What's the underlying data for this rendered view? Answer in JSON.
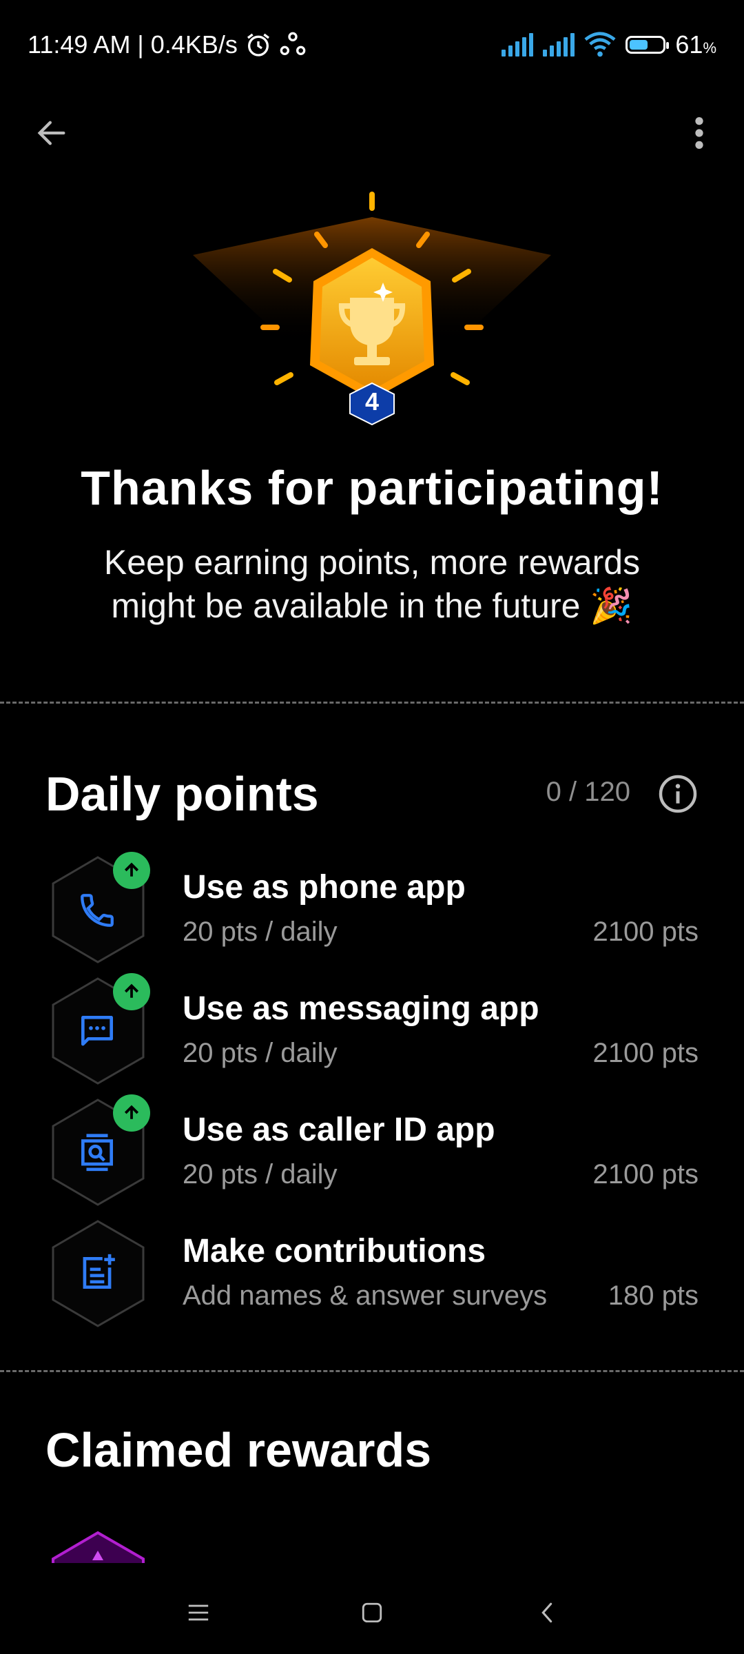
{
  "status_bar": {
    "time_speed": "11:49 AM | 0.4KB/s",
    "battery": "61",
    "battery_unit": "%",
    "battery_level_percent": 61,
    "icons": [
      "alarm-icon",
      "sync-icon",
      "signal-icon",
      "signal-icon",
      "wifi-icon",
      "battery-icon"
    ]
  },
  "toolbar": {
    "back_icon": "arrow-left-icon",
    "more_icon": "more-vert-icon"
  },
  "badge": {
    "level": "4",
    "icon": "trophy-icon"
  },
  "header": {
    "title": "Thanks for participating!",
    "subtitle_line1": "Keep earning points, more rewards",
    "subtitle_line2": "might be available in the future",
    "emoji": "🎉"
  },
  "daily": {
    "title": "Daily points",
    "progress": "0 / 120",
    "info_icon": "info-icon",
    "tasks": [
      {
        "title": "Use as phone app",
        "subtitle": "20 pts / daily",
        "points": "2100 pts",
        "icon": "phone-icon",
        "boosted": true
      },
      {
        "title": "Use as messaging app",
        "subtitle": "20 pts / daily",
        "points": "2100 pts",
        "icon": "message-icon",
        "boosted": true
      },
      {
        "title": "Use as caller ID app",
        "subtitle": "20 pts / daily",
        "points": "2100 pts",
        "icon": "caller-id-icon",
        "boosted": true
      },
      {
        "title": "Make contributions",
        "subtitle": "Add names & answer surveys",
        "points": "180 pts",
        "icon": "note-add-icon",
        "boosted": false
      }
    ]
  },
  "claimed": {
    "title": "Claimed rewards"
  },
  "colors": {
    "accent_blue": "#2f7cf6",
    "badge_green": "#2bbb5c",
    "gold": "#f2a20c",
    "claimed_purple": "#b21fd0"
  },
  "navbar": {
    "icons": [
      "menu-icon",
      "home-icon",
      "back-icon"
    ]
  }
}
